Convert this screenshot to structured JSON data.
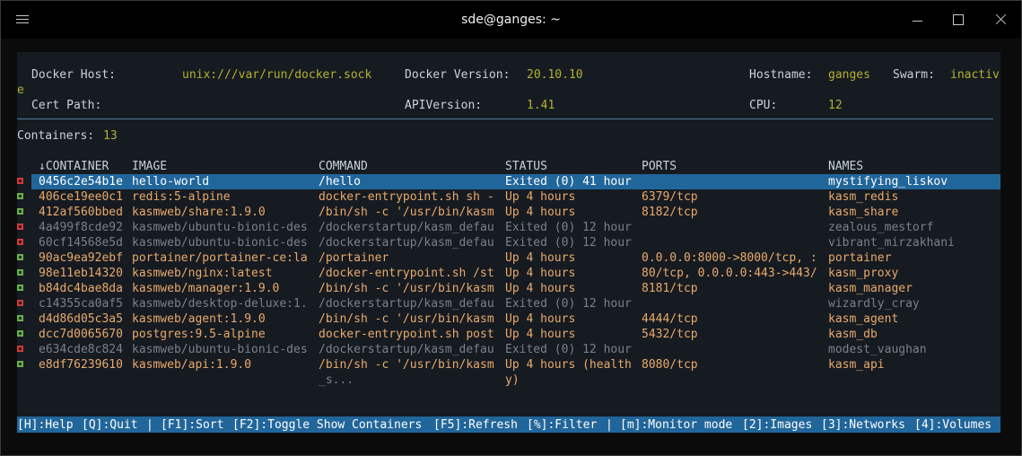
{
  "window": {
    "title": "sde@ganges: ~"
  },
  "info": {
    "docker_host_label": "Docker Host:",
    "docker_host_value": "unix:///var/run/docker.sock",
    "docker_version_label": "Docker Version:",
    "docker_version_value": "20.10.10",
    "hostname_label": "Hostname:",
    "hostname_value": "ganges",
    "swarm_label": "Swarm:",
    "swarm_value": "inactiv",
    "swarm_value_wrap": "e",
    "cert_path_label": "Cert Path:",
    "api_version_label": "APIVersion:",
    "api_version_value": "1.41",
    "cpu_label": "CPU:",
    "cpu_value": "12"
  },
  "summary": {
    "containers_label": "Containers:",
    "containers_count": "13"
  },
  "table": {
    "headers": [
      "↓CONTAINER",
      "IMAGE",
      "COMMAND",
      "STATUS",
      "PORTS",
      "NAMES"
    ],
    "rows": [
      {
        "state": "exited",
        "selected": true,
        "id": "0456c2e54b1e",
        "image": "hello-world",
        "command": "/hello",
        "status": "Exited (0) 41 hour",
        "ports": "",
        "name": "mystifying_liskov"
      },
      {
        "state": "up",
        "selected": false,
        "id": "406ce19ee0c1",
        "image": "redis:5-alpine",
        "command": "docker-entrypoint.sh sh -",
        "status": "Up 4 hours",
        "ports": "6379/tcp",
        "name": "kasm_redis"
      },
      {
        "state": "up",
        "selected": false,
        "id": "412af560bbed",
        "image": "kasmweb/share:1.9.0",
        "command": "/bin/sh -c '/usr/bin/kasm",
        "status": "Up 4 hours",
        "ports": "8182/tcp",
        "name": "kasm_share"
      },
      {
        "state": "exited",
        "selected": false,
        "id": "4a499f8cde92",
        "image": "kasmweb/ubuntu-bionic-des",
        "command": "/dockerstartup/kasm_defau",
        "status": "Exited (0) 12 hour",
        "ports": "",
        "name": "zealous_mestorf"
      },
      {
        "state": "exited",
        "selected": false,
        "id": "60cf14568e5d",
        "image": "kasmweb/ubuntu-bionic-des",
        "command": "/dockerstartup/kasm_defau",
        "status": "Exited (0) 12 hour",
        "ports": "",
        "name": "vibrant_mirzakhani"
      },
      {
        "state": "up",
        "selected": false,
        "id": "90ac9ea92ebf",
        "image": "portainer/portainer-ce:la",
        "command": "/portainer",
        "status": "Up 4 hours",
        "ports": "0.0.0.0:8000->8000/tcp, :",
        "name": "portainer"
      },
      {
        "state": "up",
        "selected": false,
        "id": "98e11eb14320",
        "image": "kasmweb/nginx:latest",
        "command": "/docker-entrypoint.sh /st",
        "status": "Up 4 hours",
        "ports": "80/tcp, 0.0.0.0:443->443/",
        "name": "kasm_proxy"
      },
      {
        "state": "up",
        "selected": false,
        "id": "b84dc4bae8da",
        "image": "kasmweb/manager:1.9.0",
        "command": "/bin/sh -c '/usr/bin/kasm",
        "status": "Up 4 hours",
        "ports": "8181/tcp",
        "name": "kasm_manager"
      },
      {
        "state": "exited",
        "selected": false,
        "id": "c14355ca0af5",
        "image": "kasmweb/desktop-deluxe:1.",
        "command": "/dockerstartup/kasm_defau",
        "status": "Exited (0) 12 hour",
        "ports": "",
        "name": "wizardly_cray"
      },
      {
        "state": "up",
        "selected": false,
        "id": "d4d86d05c3a5",
        "image": "kasmweb/agent:1.9.0",
        "command": "/bin/sh -c '/usr/bin/kasm",
        "status": "Up 4 hours",
        "ports": "4444/tcp",
        "name": "kasm_agent"
      },
      {
        "state": "up",
        "selected": false,
        "id": "dcc7d0065670",
        "image": "postgres:9.5-alpine",
        "command": "docker-entrypoint.sh post",
        "status": "Up 4 hours",
        "ports": "5432/tcp",
        "name": "kasm_db"
      },
      {
        "state": "exited",
        "selected": false,
        "id": "e634cde8c824",
        "image": "kasmweb/ubuntu-bionic-des",
        "command": "/dockerstartup/kasm_defau",
        "status": "Exited (0) 12 hour",
        "ports": "",
        "name": "modest_vaughan"
      },
      {
        "state": "up",
        "selected": false,
        "id": "e8df76239610",
        "image": "kasmweb/api:1.9.0",
        "command": "/bin/sh -c '/usr/bin/kasm",
        "status": "Up 4 hours (health",
        "ports": "8080/tcp",
        "name": "kasm_api"
      }
    ],
    "last_row_continuation": {
      "command": "_s...",
      "status": "y)"
    }
  },
  "footer": {
    "keys": [
      "[H]:Help",
      "[Q]:Quit",
      "|",
      "[F1]:Sort",
      "[F2]:Toggle Show Containers",
      "[F5]:Refresh",
      "[%]:Filter",
      "|",
      "[m]:Monitor mode",
      "[2]:Images",
      "[3]:Networks",
      "[4]:Volumes"
    ]
  },
  "colors": {
    "terminal_bg": "#161b22",
    "value_yellow": "#b5b02d",
    "running_orange": "#e9a96a",
    "exited_gray": "#7b8087",
    "selection_blue": "#21669b",
    "running_marker": "#6ab04c",
    "exited_marker": "#d23a3a"
  }
}
